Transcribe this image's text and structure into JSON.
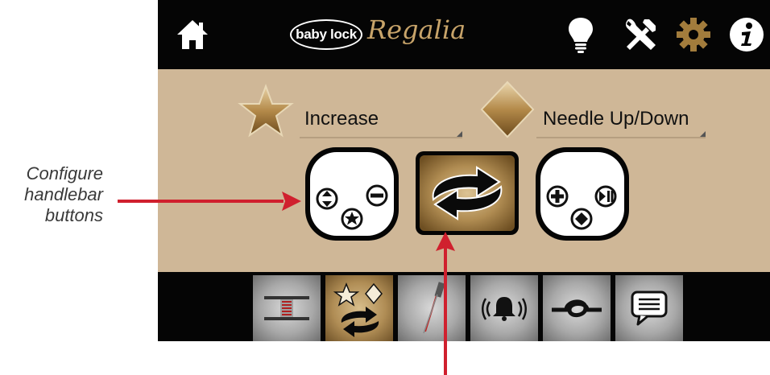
{
  "callout": {
    "line1": "Configure",
    "line2": "handlebar",
    "line3": "buttons"
  },
  "header": {
    "logo_text": "baby lock",
    "model_name": "Regalia",
    "icons": [
      "home-icon",
      "lightbulb-icon",
      "tools-icon",
      "gear-icon",
      "info-icon"
    ]
  },
  "assignments": {
    "star": {
      "label": "Increase"
    },
    "diamond": {
      "label": "Needle Up/Down"
    }
  },
  "tabs": [
    "bobbin-tab",
    "handlebar-buttons-tab",
    "needle-tab",
    "alarm-tab",
    "knot-tab",
    "message-tab"
  ],
  "colors": {
    "background": "#cfb797",
    "bar": "#050505",
    "gold": "#a27c3c",
    "arrow": "#d0202e"
  }
}
